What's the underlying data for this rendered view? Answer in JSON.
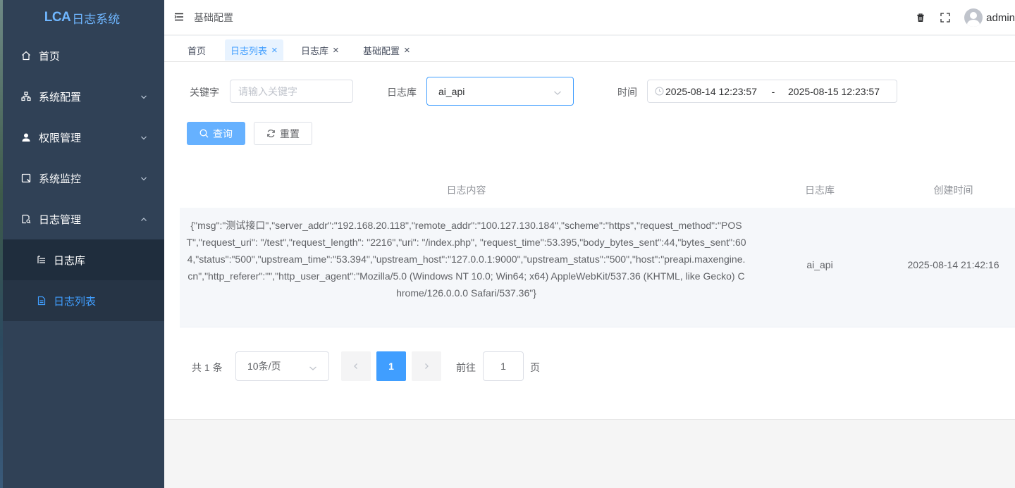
{
  "app": {
    "logo_mark": "LCA",
    "logo_text": "日志系统"
  },
  "sidebar": {
    "items": [
      {
        "label": "首页"
      },
      {
        "label": "系统配置"
      },
      {
        "label": "权限管理"
      },
      {
        "label": "系统监控"
      },
      {
        "label": "日志管理"
      }
    ],
    "subitems": [
      {
        "label": "日志库"
      },
      {
        "label": "日志列表"
      }
    ]
  },
  "header": {
    "breadcrumb": "基础配置",
    "username": "admin"
  },
  "tags": [
    {
      "label": "首页"
    },
    {
      "label": "日志列表"
    },
    {
      "label": "日志库"
    },
    {
      "label": "基础配置"
    }
  ],
  "form": {
    "keyword_label": "关键字",
    "keyword_placeholder": "请输入关键字",
    "db_label": "日志库",
    "db_value": "ai_api",
    "time_label": "时间",
    "time_start": "2025-08-14 12:23:57",
    "time_sep": "-",
    "time_end": "2025-08-15 12:23:57",
    "search_label": "查询",
    "reset_label": "重置"
  },
  "table": {
    "headers": [
      "日志内容",
      "日志库",
      "创建时间"
    ],
    "rows": [
      {
        "content": "{\"msg\":\"测试接口\",\"server_addr\":\"192.168.20.118\",\"remote_addr\":\"100.127.130.184\",\"scheme\":\"https\",\"request_method\":\"POST\",\"request_uri\": \"/test\",\"request_length\": \"2216\",\"uri\": \"/index.php\", \"request_time\":53.395,\"body_bytes_sent\":44,\"bytes_sent\":604,\"status\":\"500\",\"upstream_time\":\"53.394\",\"upstream_host\":\"127.0.0.1:9000\",\"upstream_status\":\"500\",\"host\":\"preapi.maxengine.cn\",\"http_referer\":\"\",\"http_user_agent\":\"Mozilla/5.0 (Windows NT 10.0; Win64; x64) AppleWebKit/537.36 (KHTML, like Gecko) Chrome/126.0.0.0 Safari/537.36\"}",
        "db": "ai_api",
        "created": "2025-08-14 21:42:16"
      }
    ]
  },
  "pagination": {
    "total_text": "共 1 条",
    "page_size": "10条/页",
    "current_page": "1",
    "goto_label": "前往",
    "goto_value": "1",
    "page_suffix": "页"
  }
}
